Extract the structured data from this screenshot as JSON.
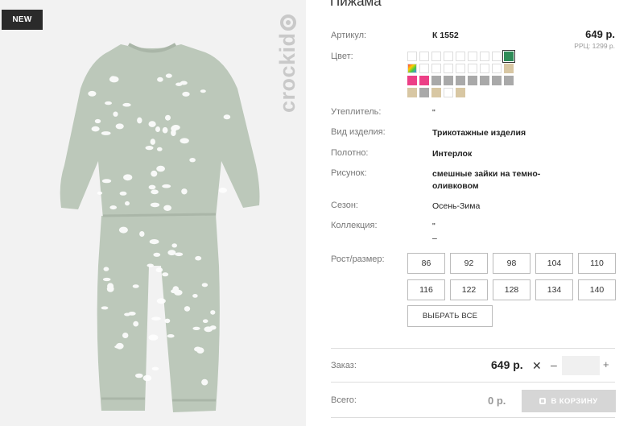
{
  "photo": {
    "badge": "NEW",
    "brand": "crockid",
    "fabric_color": "#bcc8ba",
    "print_color": "#ffffff"
  },
  "product": {
    "title": "Пижама",
    "article_label": "Артикул:",
    "article_value": "К 1552",
    "price": "649 р.",
    "rrp": "РРЦ: 1299 р.",
    "color_label": "Цвет:",
    "swatches": [
      {
        "color": "#ffffff",
        "selected": false
      },
      {
        "color": "#ffffff",
        "selected": false
      },
      {
        "color": "#ffffff",
        "selected": false
      },
      {
        "color": "#ffffff",
        "selected": false
      },
      {
        "color": "#ffffff",
        "selected": false
      },
      {
        "color": "#ffffff",
        "selected": false
      },
      {
        "color": "#ffffff",
        "selected": false
      },
      {
        "color": "#ffffff",
        "selected": false
      },
      {
        "color": "#2e8b57",
        "selected": true
      },
      {
        "color": "multicolor",
        "selected": false
      },
      {
        "color": "#ffffff",
        "selected": false
      },
      {
        "color": "#ffffff",
        "selected": false
      },
      {
        "color": "#ffffff",
        "selected": false
      },
      {
        "color": "#ffffff",
        "selected": false
      },
      {
        "color": "#ffffff",
        "selected": false
      },
      {
        "color": "#ffffff",
        "selected": false
      },
      {
        "color": "#ffffff",
        "selected": false
      },
      {
        "color": "#d8c7a3",
        "selected": false
      },
      {
        "color": "#ec3f86",
        "selected": false
      },
      {
        "color": "#ec3f86",
        "selected": false
      },
      {
        "color": "#a9a9a9",
        "selected": false
      },
      {
        "color": "#a9a9a9",
        "selected": false
      },
      {
        "color": "#a9a9a9",
        "selected": false
      },
      {
        "color": "#a9a9a9",
        "selected": false
      },
      {
        "color": "#a9a9a9",
        "selected": false
      },
      {
        "color": "#a9a9a9",
        "selected": false
      },
      {
        "color": "#a9a9a9",
        "selected": false
      },
      {
        "color": "#d8c7a3",
        "selected": false
      },
      {
        "color": "#a9a9a9",
        "selected": false
      },
      {
        "color": "#d8c7a3",
        "selected": false
      },
      {
        "color": "#ffffff",
        "selected": false
      },
      {
        "color": "#d8c7a3",
        "selected": false
      }
    ],
    "attributes": [
      {
        "label": "Утеплитель:",
        "value": "\"",
        "bold": false
      },
      {
        "label": "Вид изделия:",
        "value": "Трикотажные изделия",
        "bold": true
      },
      {
        "label": "Полотно:",
        "value": "Интерлок",
        "bold": true
      },
      {
        "label": "Рисунок:",
        "value": "смешные зайки на темно-\nоливковом",
        "bold": true
      },
      {
        "label": "Сезон:",
        "value": "Осень-Зима",
        "bold": false
      },
      {
        "label": "Коллекция:",
        "value": "\"\n–",
        "bold": false
      }
    ],
    "size_label": "Рост/размер:",
    "sizes": [
      "86",
      "92",
      "98",
      "104",
      "110",
      "116",
      "122",
      "128",
      "134",
      "140"
    ],
    "choose_all": "ВЫБРАТЬ ВСЕ"
  },
  "order": {
    "label": "Заказ:",
    "price": "649 р.",
    "times": "✕",
    "minus": "–",
    "plus": "+",
    "qty": ""
  },
  "total": {
    "label": "Всего:",
    "value": "0 р.",
    "cart_button": "В КОРЗИНУ"
  }
}
